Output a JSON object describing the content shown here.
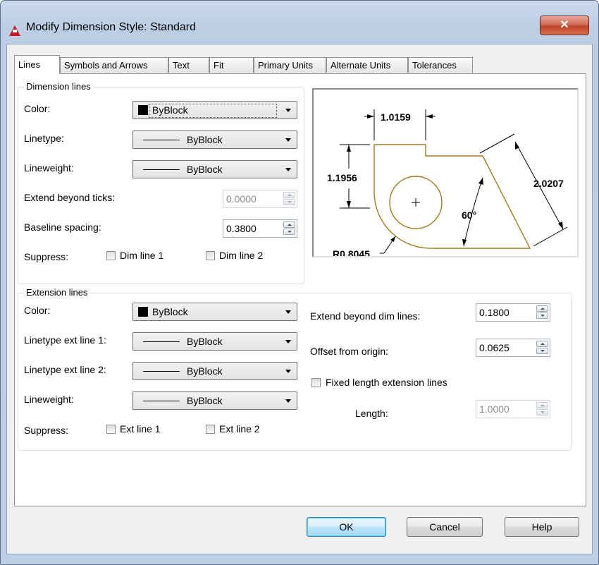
{
  "window": {
    "title": "Modify Dimension Style: Standard",
    "close_glyph": "✕"
  },
  "tabs": [
    "Lines",
    "Symbols and Arrows",
    "Text",
    "Fit",
    "Primary Units",
    "Alternate Units",
    "Tolerances"
  ],
  "dimension_lines": {
    "title": "Dimension lines",
    "color_label": "Color:",
    "color_value": "ByBlock",
    "linetype_label": "Linetype:",
    "linetype_value": "ByBlock",
    "lineweight_label": "Lineweight:",
    "lineweight_value": "ByBlock",
    "extend_label": "Extend beyond ticks:",
    "extend_value": "0.0000",
    "baseline_label": "Baseline spacing:",
    "baseline_value": "0.3800",
    "suppress_label": "Suppress:",
    "dim_line_1": "Dim line 1",
    "dim_line_2": "Dim line 2"
  },
  "preview": {
    "top_dim": "1.0159",
    "left_dim": "1.1956",
    "right_dim": "2.0207",
    "angle": "60°",
    "radius": "R0.8045"
  },
  "extension_lines": {
    "title": "Extension lines",
    "color_label": "Color:",
    "color_value": "ByBlock",
    "ext1_label": "Linetype ext line 1:",
    "ext1_value": "ByBlock",
    "ext2_label": "Linetype ext line 2:",
    "ext2_value": "ByBlock",
    "lineweight_label": "Lineweight:",
    "lineweight_value": "ByBlock",
    "suppress_label": "Suppress:",
    "ext_line_1": "Ext line 1",
    "ext_line_2": "Ext line 2",
    "extend_beyond_label": "Extend beyond dim lines:",
    "extend_beyond_value": "0.1800",
    "offset_label": "Offset from origin:",
    "offset_value": "0.0625",
    "fixed_length_label": "Fixed length extension lines",
    "length_label": "Length:",
    "length_value": "1.0000"
  },
  "buttons": {
    "ok": "OK",
    "cancel": "Cancel",
    "help": "Help"
  },
  "colors": {
    "accent": "#c0432c",
    "default_button": "#3c7fb1",
    "preview_geometry": "#a07a1e"
  }
}
